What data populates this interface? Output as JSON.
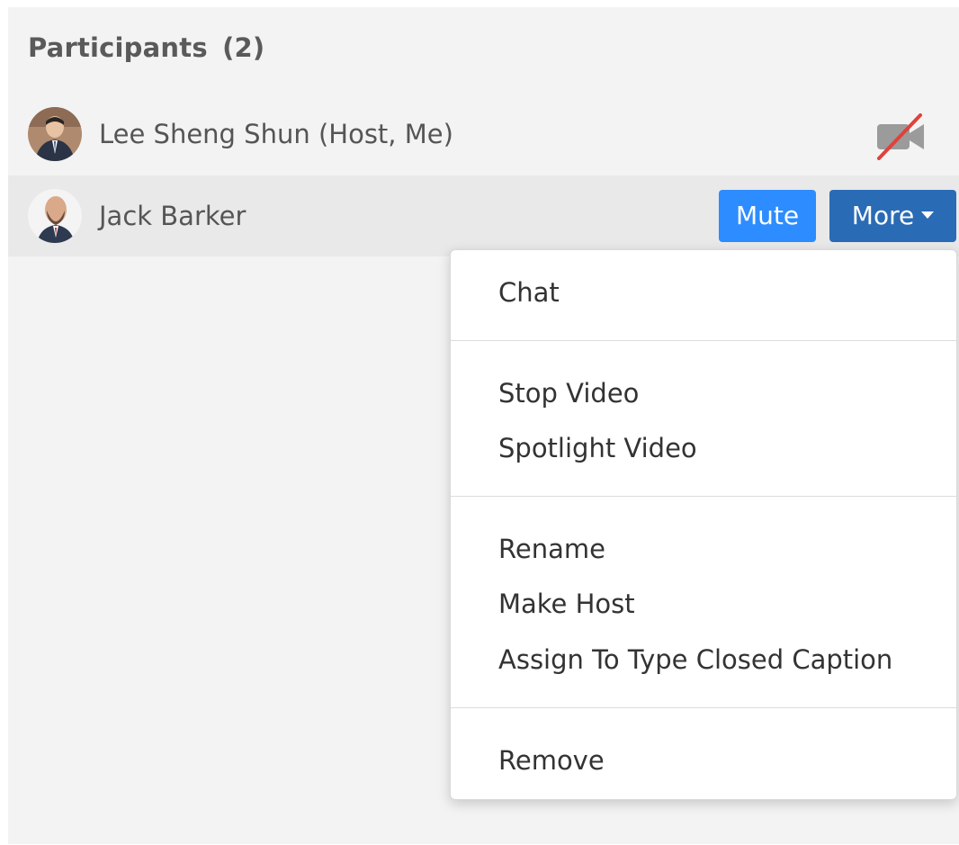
{
  "panel": {
    "title": "Participants",
    "count": "(2)"
  },
  "participants": [
    {
      "name": "Lee Sheng Shun (Host, Me)",
      "video_icon": "video-off-icon"
    },
    {
      "name": "Jack Barker"
    }
  ],
  "actions": {
    "mute_label": "Mute",
    "more_label": "More"
  },
  "menu": {
    "items": [
      "Chat",
      "Stop Video",
      "Spotlight Video",
      "Rename",
      "Make Host",
      "Assign To Type Closed Caption",
      "Remove"
    ]
  },
  "colors": {
    "mute_button": "#2d8cff",
    "more_button": "#2a6bb5",
    "video_off_slash": "#e0413b"
  }
}
